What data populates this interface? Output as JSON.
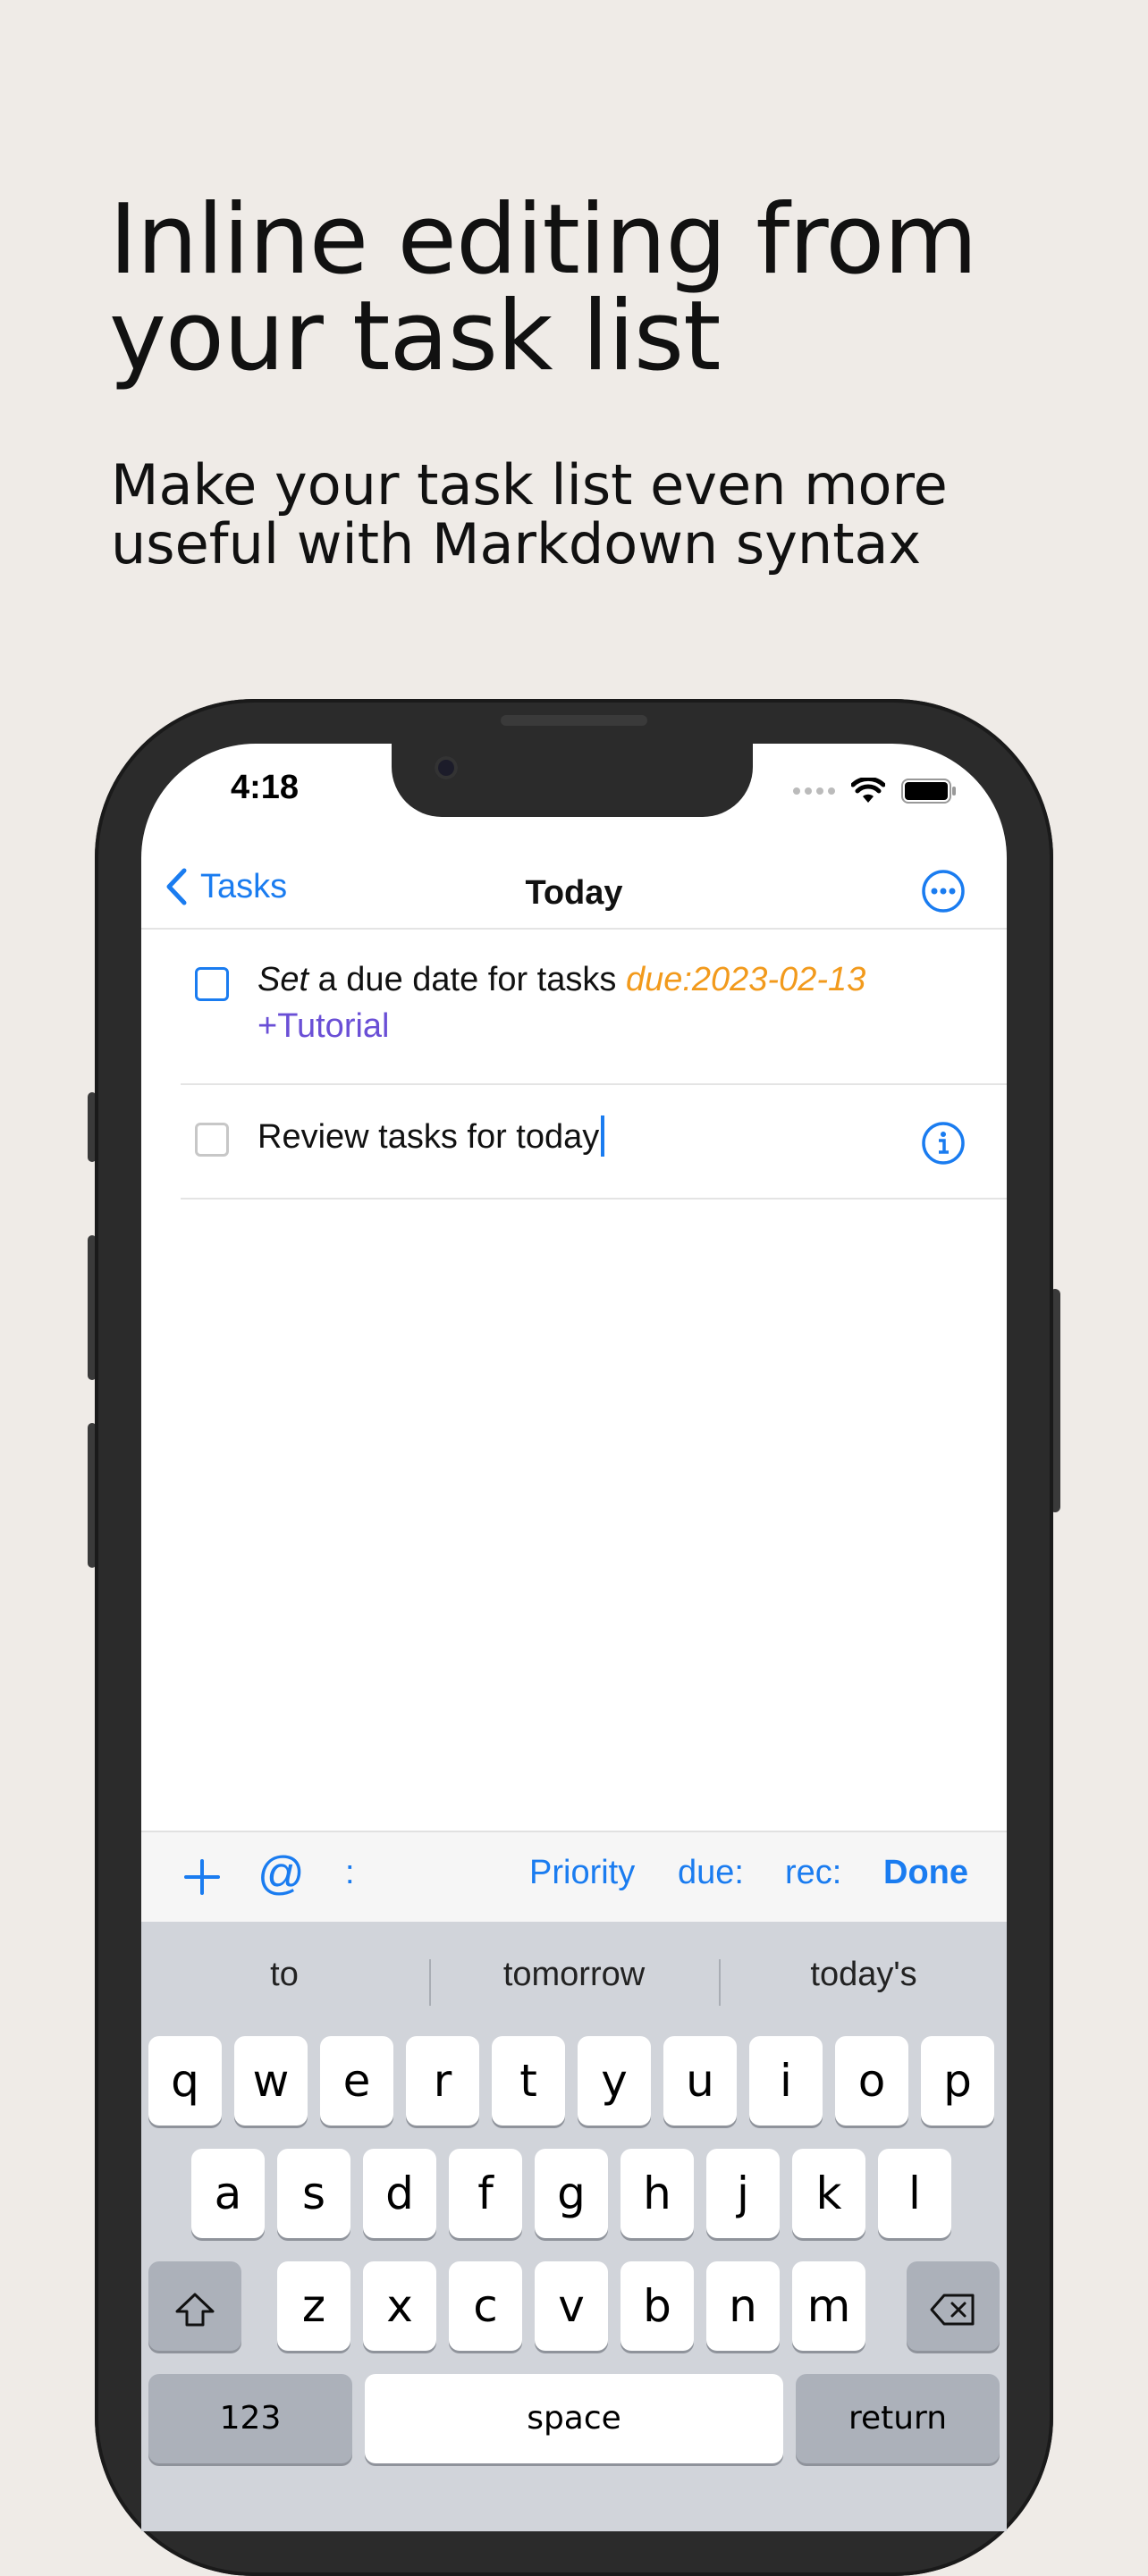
{
  "marketing": {
    "headline_line1": "Inline editing from",
    "headline_line2": "your task list",
    "subhead_line1": "Make your task list even more",
    "subhead_line2": "useful with Markdown syntax"
  },
  "status_bar": {
    "time": "4:18"
  },
  "nav": {
    "back_label": "Tasks",
    "title": "Today"
  },
  "tasks": [
    {
      "word_italic": "Set",
      "text": "a due date for tasks",
      "due": "due:2023-02-13",
      "project": "+Tutorial"
    },
    {
      "text": "Review tasks for today"
    }
  ],
  "toolbar": {
    "add": "+",
    "at": "@",
    "colon": ":",
    "priority": "Priority",
    "due": "due:",
    "rec": "rec:",
    "done": "Done"
  },
  "keyboard": {
    "suggestions": [
      "to",
      "tomorrow",
      "today's"
    ],
    "row1": [
      "q",
      "w",
      "e",
      "r",
      "t",
      "y",
      "u",
      "i",
      "o",
      "p"
    ],
    "row2": [
      "a",
      "s",
      "d",
      "f",
      "g",
      "h",
      "j",
      "k",
      "l"
    ],
    "row3": [
      "z",
      "x",
      "c",
      "v",
      "b",
      "n",
      "m"
    ],
    "numbers": "123",
    "space": "space",
    "return": "return"
  },
  "colors": {
    "accent": "#1a7cf0",
    "due": "#f29a1c",
    "project": "#6a4fd6",
    "background": "#efebe7"
  }
}
